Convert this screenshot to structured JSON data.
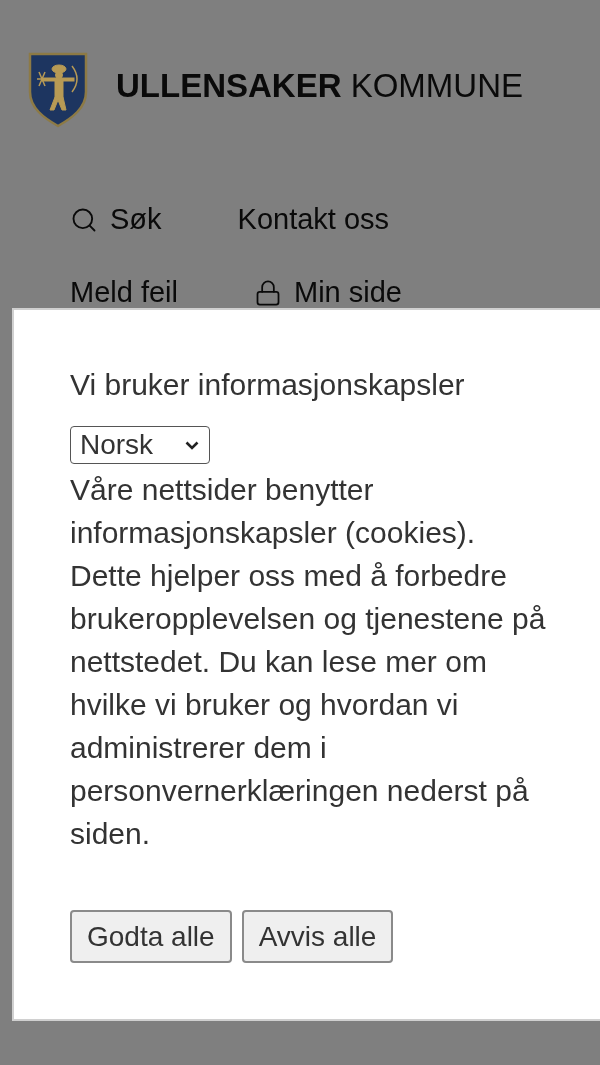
{
  "header": {
    "title": "**ULLENSAKER** KOMMUNE"
  },
  "nav": [
    [
      {
        "kind": "search",
        "label": "Søk"
      },
      {
        "kind": "plain",
        "label": "Kontakt oss"
      }
    ],
    [
      {
        "kind": "plain",
        "label": "Meld feil"
      },
      {
        "kind": "lock",
        "label": "Min side"
      }
    ]
  ],
  "cookie_dialog": {
    "title": "Vi bruker informasjonskapsler",
    "language_select": {
      "value": "Norsk"
    },
    "text": "Våre nettsider benytter informasjonskapsler (cookies). Dette hjelper oss med å forbedre brukeropplevelsen og tjenestene på nettstedet. Du kan lese mer om hvilke vi bruker og hvordan vi administrerer dem i personvernerklæringen nederst på siden.",
    "buttons": [
      "Godta alle",
      "Avvis alle"
    ]
  }
}
